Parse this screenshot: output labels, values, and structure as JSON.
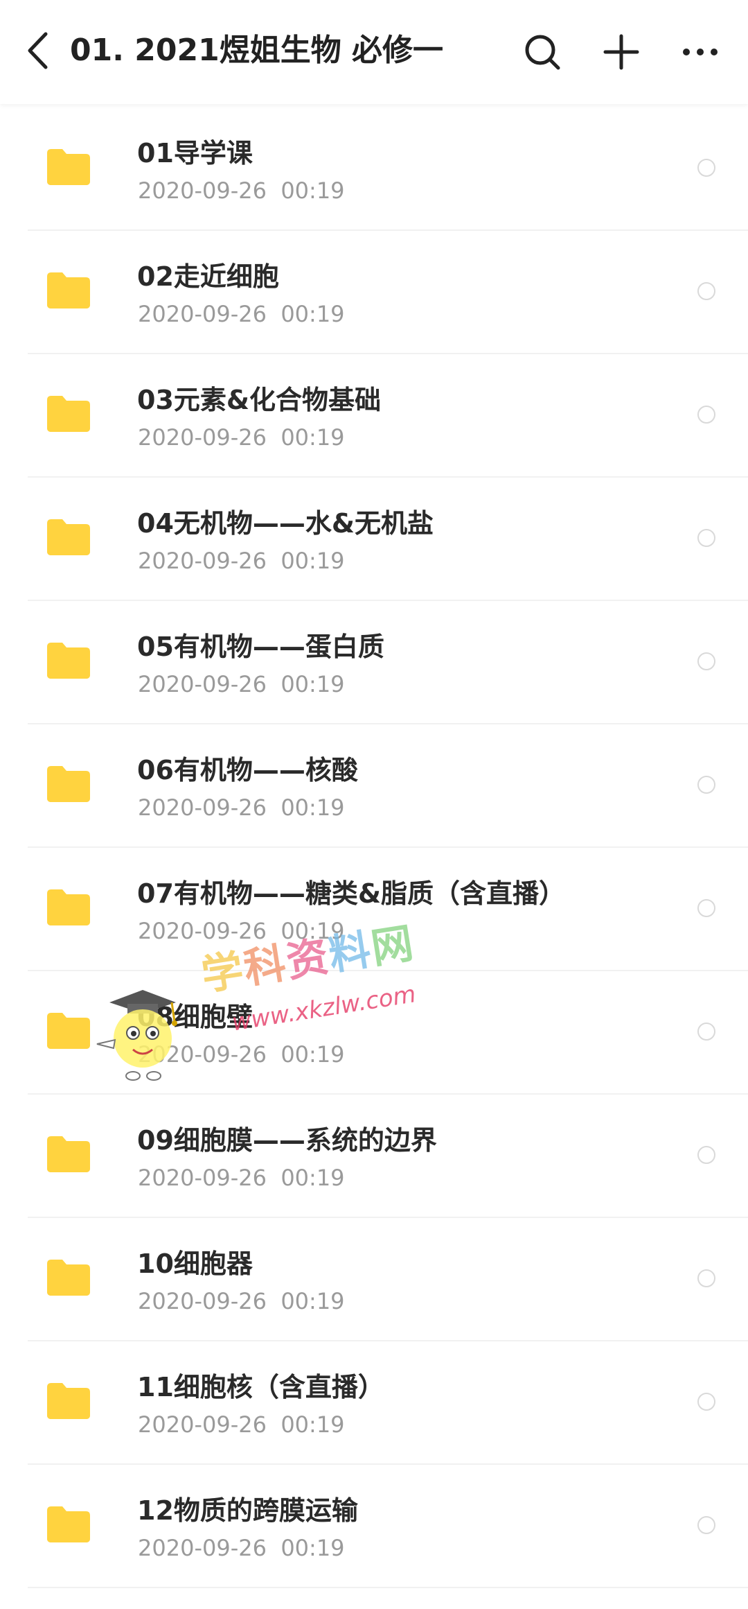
{
  "header": {
    "title": "01. 2021煜姐生物 必修一",
    "icons": [
      "back-arrow-icon",
      "search-icon",
      "plus-icon",
      "more-dots-icon"
    ]
  },
  "colors": {
    "folder": "#ffd33f",
    "title_text": "#222222",
    "secondary_text": "#9a9a9a"
  },
  "folders": [
    {
      "name": "01导学课",
      "time": "2020-09-26  00:19"
    },
    {
      "name": "02走近细胞",
      "time": "2020-09-26  00:19"
    },
    {
      "name": "03元素&化合物基础",
      "time": "2020-09-26  00:19"
    },
    {
      "name": "04无机物——水&无机盐",
      "time": "2020-09-26  00:19"
    },
    {
      "name": "05有机物——蛋白质",
      "time": "2020-09-26  00:19"
    },
    {
      "name": "06有机物——核酸",
      "time": "2020-09-26  00:19"
    },
    {
      "name": "07有机物——糖类&脂质（含直播）",
      "time": "2020-09-26  00:19"
    },
    {
      "name": "08细胞壁",
      "time": "2020-09-26  00:19"
    },
    {
      "name": "09细胞膜——系统的边界",
      "time": "2020-09-26  00:19"
    },
    {
      "name": "10细胞器",
      "time": "2020-09-26  00:19"
    },
    {
      "name": "11细胞核（含直播）",
      "time": "2020-09-26  00:19"
    },
    {
      "name": "12物质的跨膜运输",
      "time": "2020-09-26  00:19"
    }
  ],
  "watermark": {
    "title": "学科资料网",
    "url": "www.xkzlw.com"
  }
}
